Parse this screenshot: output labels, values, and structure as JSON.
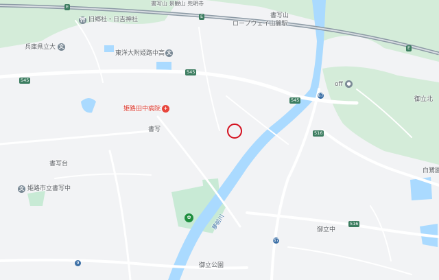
{
  "map": {
    "place_labels": {
      "kyugo_hiyoshi": "旧郷社・日吉神社",
      "hyogo_kenritsu": "兵庫県立大",
      "toyo_daifu": "東洋大附姫路中高",
      "himeji_tanaka_hospital": "姫路田中病院",
      "shosha": "書写",
      "shosha_dai": "書写台",
      "himeji_shiritsu": "姫路市立書写中",
      "shoshazan": "書写山",
      "ropeway": "ロープウェイ山麓駅",
      "off": "off",
      "goritsu_kita": "御立北",
      "goritsu_naka": "御立中",
      "goritsu_koen": "御立公園",
      "hakuro": "白鷺園",
      "yumesaki_river": "夢前川",
      "top_partial": "書写山 景観山 兜明寺"
    },
    "road_numbers": [
      "545",
      "545",
      "545",
      "67",
      "67",
      "516",
      "516",
      "9"
    ],
    "expressway_shields": [
      "E",
      "E",
      "E"
    ],
    "colors": {
      "water": "#aadaff",
      "park": "#c8ead5",
      "forest": "#d4ecd9",
      "road": "#ffffff",
      "expressway": "#8c9aa5",
      "marker": "#d4101e"
    }
  }
}
